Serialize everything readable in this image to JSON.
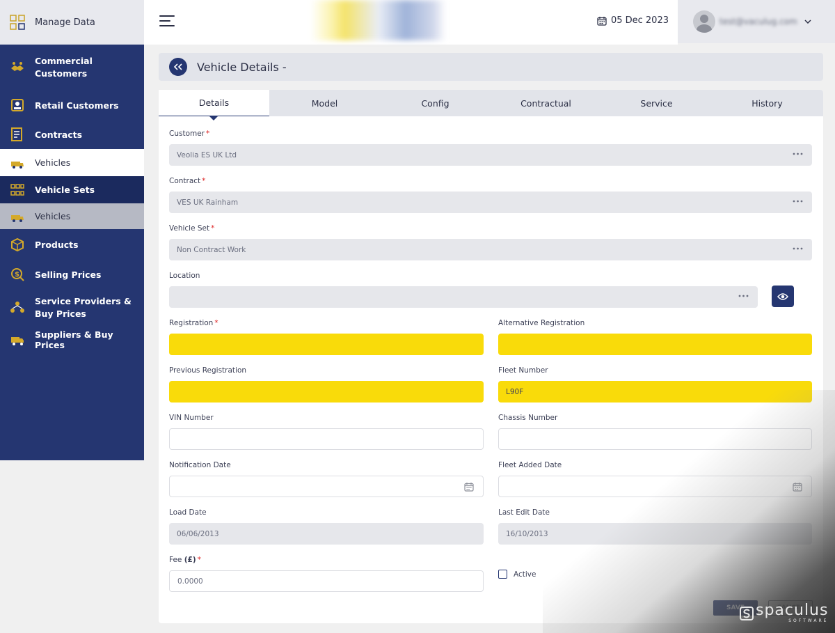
{
  "brand": {
    "label": "Manage Data"
  },
  "header": {
    "date": "05 Dec 2023",
    "user_email": "test@vaculug.com"
  },
  "sidebar": {
    "items": [
      {
        "label": "Commercial Customers",
        "icon": "handshake-icon"
      },
      {
        "label": "Retail Customers",
        "icon": "retail-icon"
      },
      {
        "label": "Contracts",
        "icon": "contract-icon"
      },
      {
        "label": "Vehicles",
        "icon": "vehicle-icon"
      },
      {
        "label": "Vehicle Sets",
        "icon": "vehicle-sets-icon"
      },
      {
        "label": "Vehicles",
        "icon": "vehicle-icon"
      },
      {
        "label": "Products",
        "icon": "products-icon"
      },
      {
        "label": "Selling Prices",
        "icon": "selling-prices-icon"
      },
      {
        "label": "Service Providers & Buy Prices",
        "icon": "service-providers-icon"
      },
      {
        "label": "Suppliers & Buy Prices",
        "icon": "suppliers-icon"
      }
    ]
  },
  "page": {
    "title": "Vehicle Details -"
  },
  "tabs": [
    "Details",
    "Model",
    "Config",
    "Contractual",
    "Service",
    "History"
  ],
  "form": {
    "customer": {
      "label": "Customer",
      "value": "Veolia ES UK Ltd"
    },
    "contract": {
      "label": "Contract",
      "value": "VES UK Rainham"
    },
    "vehicle_set": {
      "label": "Vehicle Set",
      "value": "Non Contract Work"
    },
    "location": {
      "label": "Location",
      "value": ""
    },
    "registration": {
      "label": "Registration",
      "value": ""
    },
    "alt_registration": {
      "label": "Alternative Registration",
      "value": ""
    },
    "prev_registration": {
      "label": "Previous Registration",
      "value": ""
    },
    "fleet_number": {
      "label": "Fleet Number",
      "value": "L90F"
    },
    "vin_number": {
      "label": "VIN Number",
      "value": ""
    },
    "chassis_number": {
      "label": "Chassis Number",
      "value": ""
    },
    "notification_date": {
      "label": "Notification Date",
      "value": ""
    },
    "fleet_added_date": {
      "label": "Fleet Added Date",
      "value": ""
    },
    "load_date": {
      "label": "Load Date",
      "value": "06/06/2013"
    },
    "last_edit_date": {
      "label": "Last Edit Date",
      "value": "16/10/2013"
    },
    "fee": {
      "label": "Fee",
      "label_unit": "(£)",
      "value": "0.0000"
    },
    "active": {
      "label": "Active"
    },
    "required_marker": "*"
  },
  "actions": {
    "save": "SAVE",
    "cancel": "CANCEL"
  },
  "watermark": {
    "name": "spaculus",
    "sub": "SOFTWARE"
  },
  "colors": {
    "sidebar": "#253671",
    "accent_yellow": "#f9db0a",
    "required": "#dd2222"
  }
}
